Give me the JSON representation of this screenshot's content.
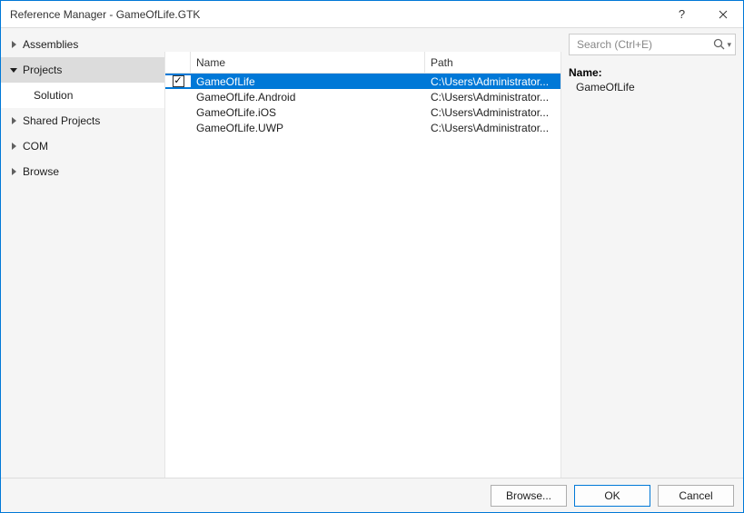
{
  "window": {
    "title": "Reference Manager - GameOfLife.GTK",
    "help_tooltip": "?",
    "close_tooltip": "Close"
  },
  "search": {
    "placeholder": "Search (Ctrl+E)"
  },
  "sidebar": {
    "assemblies": "Assemblies",
    "projects": "Projects",
    "solution": "Solution",
    "shared_projects": "Shared Projects",
    "com": "COM",
    "browse": "Browse"
  },
  "columns": {
    "name": "Name",
    "path": "Path"
  },
  "rows": [
    {
      "checked": true,
      "selected": true,
      "name": "GameOfLife",
      "path": "C:\\Users\\Administrator..."
    },
    {
      "checked": false,
      "selected": false,
      "name": "GameOfLife.Android",
      "path": "C:\\Users\\Administrator..."
    },
    {
      "checked": false,
      "selected": false,
      "name": "GameOfLife.iOS",
      "path": "C:\\Users\\Administrator..."
    },
    {
      "checked": false,
      "selected": false,
      "name": "GameOfLife.UWP",
      "path": "C:\\Users\\Administrator..."
    }
  ],
  "detail": {
    "label": "Name:",
    "value": "GameOfLife"
  },
  "buttons": {
    "browse": "Browse...",
    "ok": "OK",
    "cancel": "Cancel"
  }
}
